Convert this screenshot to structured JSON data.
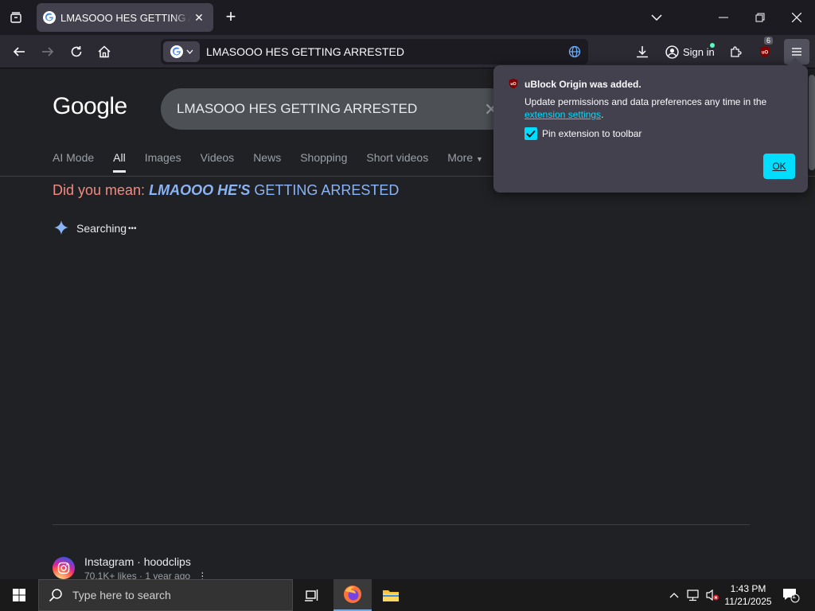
{
  "browser": {
    "tab_title": "LMASOOO HES GETTING ARRESTED",
    "url_text": "LMASOOO HES GETTING ARRESTED",
    "sign_in_label": "Sign in",
    "extensions_badge": "6"
  },
  "google": {
    "logo_text": "Google",
    "query": "LMASOOO HES GETTING ARRESTED",
    "tabs": [
      "AI Mode",
      "All",
      "Images",
      "Videos",
      "News",
      "Shopping",
      "Short videos",
      "More"
    ],
    "active_tab": "All",
    "did_you_mean_label": "Did you mean:",
    "did_you_mean_bold": "LMAOOO HE'S",
    "did_you_mean_rest": " GETTING ARRESTED",
    "searching_text": "Searching",
    "result": {
      "source": "Instagram · hoodclips",
      "meta": "70.1K+ likes · 1 year ago"
    }
  },
  "popup": {
    "title": "uBlock Origin was added.",
    "desc_prefix": "Update permissions and data preferences any time in the",
    "desc_link": "extension settings",
    "desc_suffix": ".",
    "pin_label": "Pin extension to toolbar",
    "pin_checked": true,
    "ok_label": "OK"
  },
  "taskbar": {
    "search_placeholder": "Type here to search",
    "time": "1:43 PM",
    "date": "11/21/2025",
    "notifications": "1"
  },
  "colors": {
    "accent": "#00ddff",
    "dym_label": "#f28b82",
    "dym_link": "#8ab4f8"
  }
}
